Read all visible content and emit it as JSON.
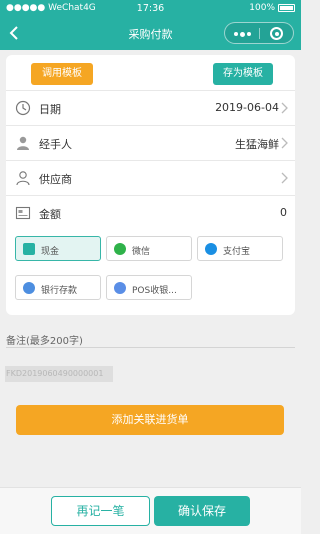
{
  "status_bar": {
    "carrier": "●●●●● WeChat4G",
    "time": "17:36",
    "battery": "100%"
  },
  "nav": {
    "title": "采购付款"
  },
  "templates": {
    "use_label": "调用模板",
    "save_label": "存为模板"
  },
  "form": {
    "date": {
      "label": "日期",
      "value": "2019-06-04"
    },
    "handler": {
      "label": "经手人",
      "value": "生猛海鲜"
    },
    "supplier": {
      "label": "供应商",
      "value": ""
    },
    "amount": {
      "label": "金额",
      "value": "0"
    }
  },
  "payment_methods": [
    {
      "label": "现金",
      "selected": true,
      "color": "#27b1a3"
    },
    {
      "label": "微信",
      "selected": false,
      "color": "#2fb24a"
    },
    {
      "label": "支付宝",
      "selected": false,
      "color": "#1a8fe3"
    },
    {
      "label": "银行存款",
      "selected": false,
      "color": "#4d8ee0"
    },
    {
      "label": "POS收银...",
      "selected": false,
      "color": "#5a8ee6"
    }
  ],
  "remark": {
    "label": "备注(最多200字)"
  },
  "order_code": "FKD2019060490000001",
  "link_button": "添加关联进货单",
  "footer": {
    "again_label": "再记一笔",
    "confirm_label": "确认保存"
  },
  "colors": {
    "primary": "#27b1a3",
    "accent": "#f5a623"
  }
}
